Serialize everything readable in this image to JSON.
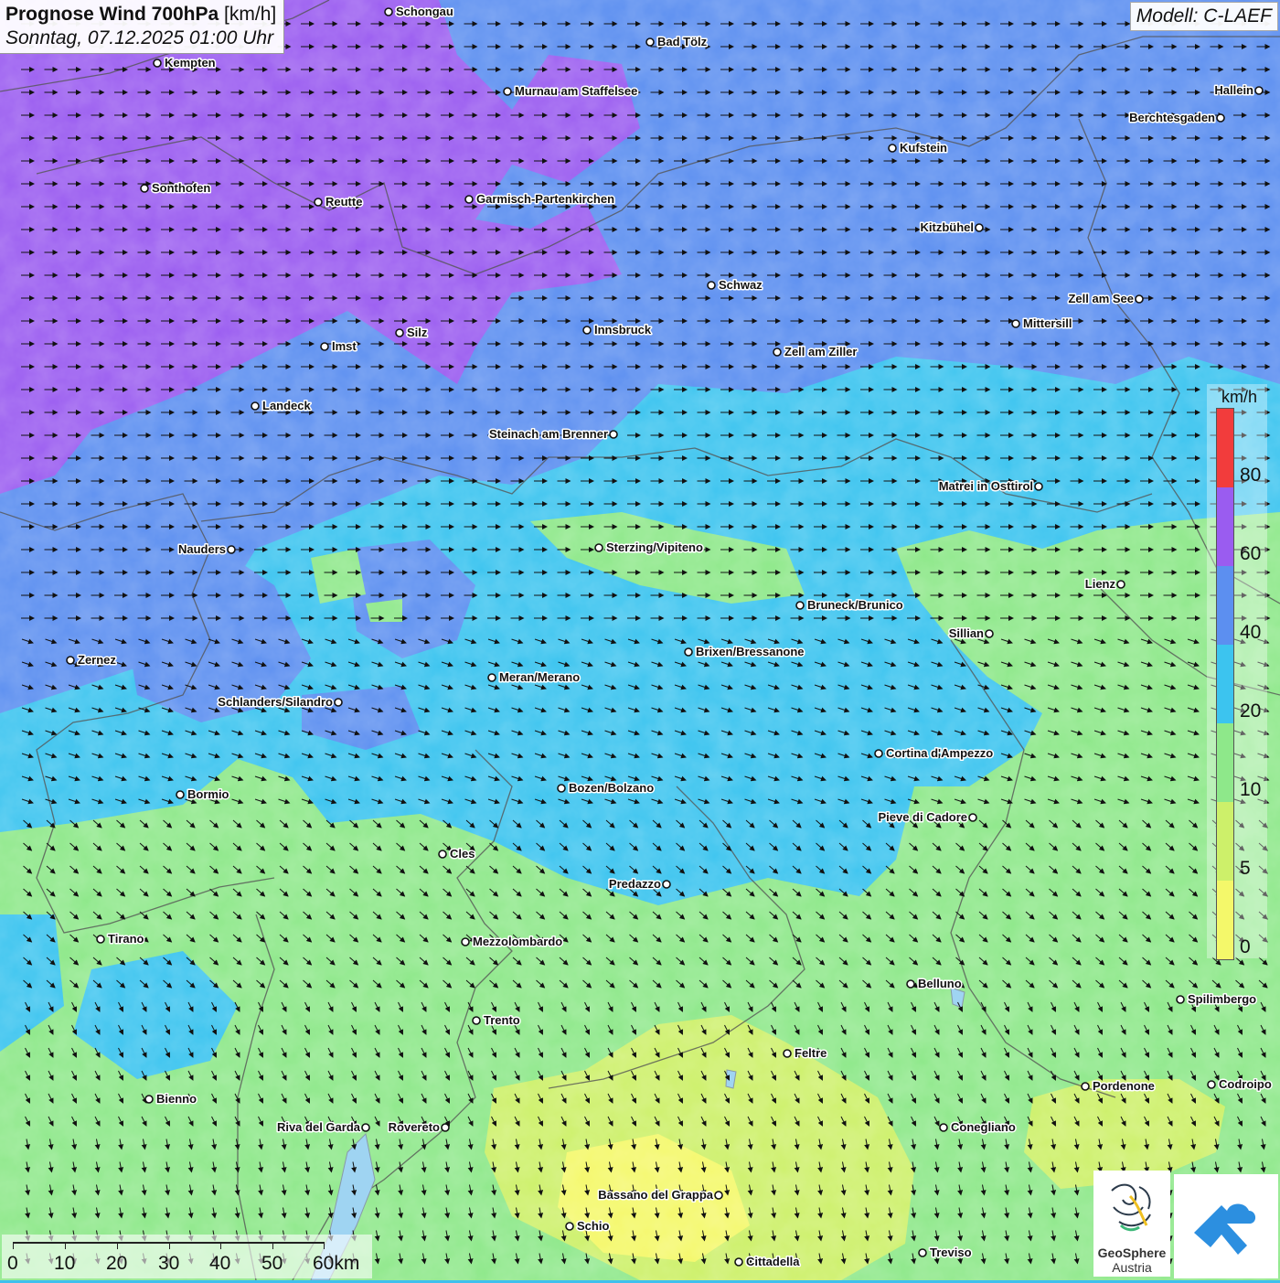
{
  "title": {
    "main_bold": "Prognose Wind 700hPa",
    "main_unit": "[km/h]",
    "subtitle": "Sonntag, 07.12.2025 01:00 Uhr"
  },
  "model": "Modell: C-LAEF",
  "colors": {
    "c0": "#f4f86a",
    "c5": "#cdf06a",
    "c10": "#8ee88a",
    "c20": "#3cc4ef",
    "c40": "#5c8ff0",
    "c60": "#9a5cf0",
    "c80": "#f23c3c"
  },
  "legend": {
    "unit": "km/h",
    "labels": [
      "80",
      "60",
      "40",
      "20",
      "10",
      "5",
      "0"
    ]
  },
  "scalebar": {
    "labels": [
      "0",
      "10",
      "20",
      "30",
      "40",
      "50",
      "60km"
    ]
  },
  "logos": {
    "geosphere_line1": "GeoSphere",
    "geosphere_line2": "Austria"
  },
  "cities": [
    {
      "name": "Schongau"
    },
    {
      "name": "Bad Tölz"
    },
    {
      "name": "Kempten"
    },
    {
      "name": "Murnau am Staffelsee"
    },
    {
      "name": "Hallein"
    },
    {
      "name": "Berchtesgaden"
    },
    {
      "name": "Kufstein"
    },
    {
      "name": "Sonthofen"
    },
    {
      "name": "Reutte"
    },
    {
      "name": "Garmisch-Partenkirchen"
    },
    {
      "name": "Kitzbühel"
    },
    {
      "name": "Schwaz"
    },
    {
      "name": "Zell am See"
    },
    {
      "name": "Mittersill"
    },
    {
      "name": "Silz"
    },
    {
      "name": "Innsbruck"
    },
    {
      "name": "Imst"
    },
    {
      "name": "Zell am Ziller"
    },
    {
      "name": "Landeck"
    },
    {
      "name": "Steinach am Brenner"
    },
    {
      "name": "Matrei in Osttirol"
    },
    {
      "name": "Nauders"
    },
    {
      "name": "Sterzing/Vipiteno"
    },
    {
      "name": "Lienz"
    },
    {
      "name": "Bruneck/Brunico"
    },
    {
      "name": "Sillian"
    },
    {
      "name": "Zernez"
    },
    {
      "name": "Brixen/Bressanone"
    },
    {
      "name": "Meran/Merano"
    },
    {
      "name": "Schlanders/Silandro"
    },
    {
      "name": "Cortina d'Ampezzo"
    },
    {
      "name": "Bozen/Bolzano"
    },
    {
      "name": "Bormio"
    },
    {
      "name": "Pieve di Cadore"
    },
    {
      "name": "Cles"
    },
    {
      "name": "Predazzo"
    },
    {
      "name": "Tirano"
    },
    {
      "name": "Mezzolombardo"
    },
    {
      "name": "Belluno"
    },
    {
      "name": "Spilimbergo"
    },
    {
      "name": "Trento"
    },
    {
      "name": "Feltre"
    },
    {
      "name": "Bienno"
    },
    {
      "name": "Pordenone"
    },
    {
      "name": "Codroipo"
    },
    {
      "name": "Riva del Garda"
    },
    {
      "name": "Rovereto"
    },
    {
      "name": "Conegliano"
    },
    {
      "name": "Bassano del Grappa"
    },
    {
      "name": "Schio"
    },
    {
      "name": "Treviso"
    },
    {
      "name": "Cittadella"
    }
  ]
}
